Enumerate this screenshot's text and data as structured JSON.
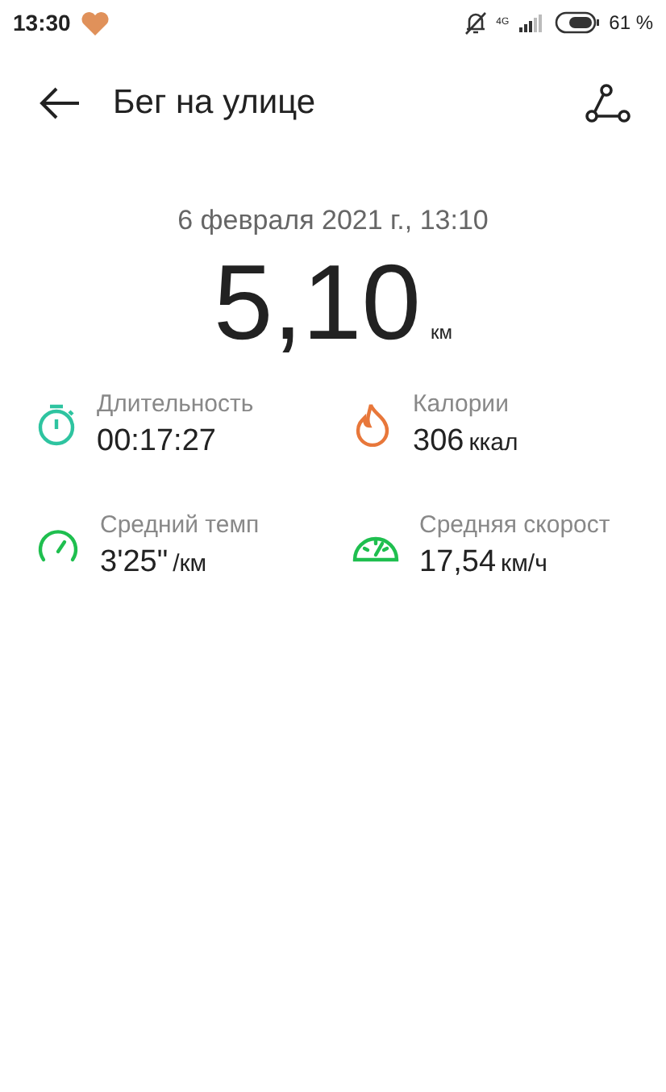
{
  "status_bar": {
    "time": "13:30",
    "network": "4G",
    "battery": "61 %"
  },
  "header": {
    "title": "Бег на улице"
  },
  "summary": {
    "date": "6 февраля 2021 г., 13:10",
    "distance": "5,10",
    "unit": "км"
  },
  "stats": [
    {
      "kind": "stopwatch",
      "color": "#2ec4a0",
      "label": "Длительность",
      "value": "00:17:27"
    },
    {
      "kind": "flame",
      "color": "#e8773a",
      "label": "Калории",
      "value": "306",
      "unit": "ккал"
    },
    {
      "kind": "gauge",
      "color": "#1fbf4f",
      "label": "Средний темп",
      "value": "3'25\"",
      "unit": "/км"
    },
    {
      "kind": "speedometer",
      "color": "#1fbf4f",
      "label": "Средняя скорост",
      "value": "17,54",
      "unit": "км/ч"
    }
  ]
}
